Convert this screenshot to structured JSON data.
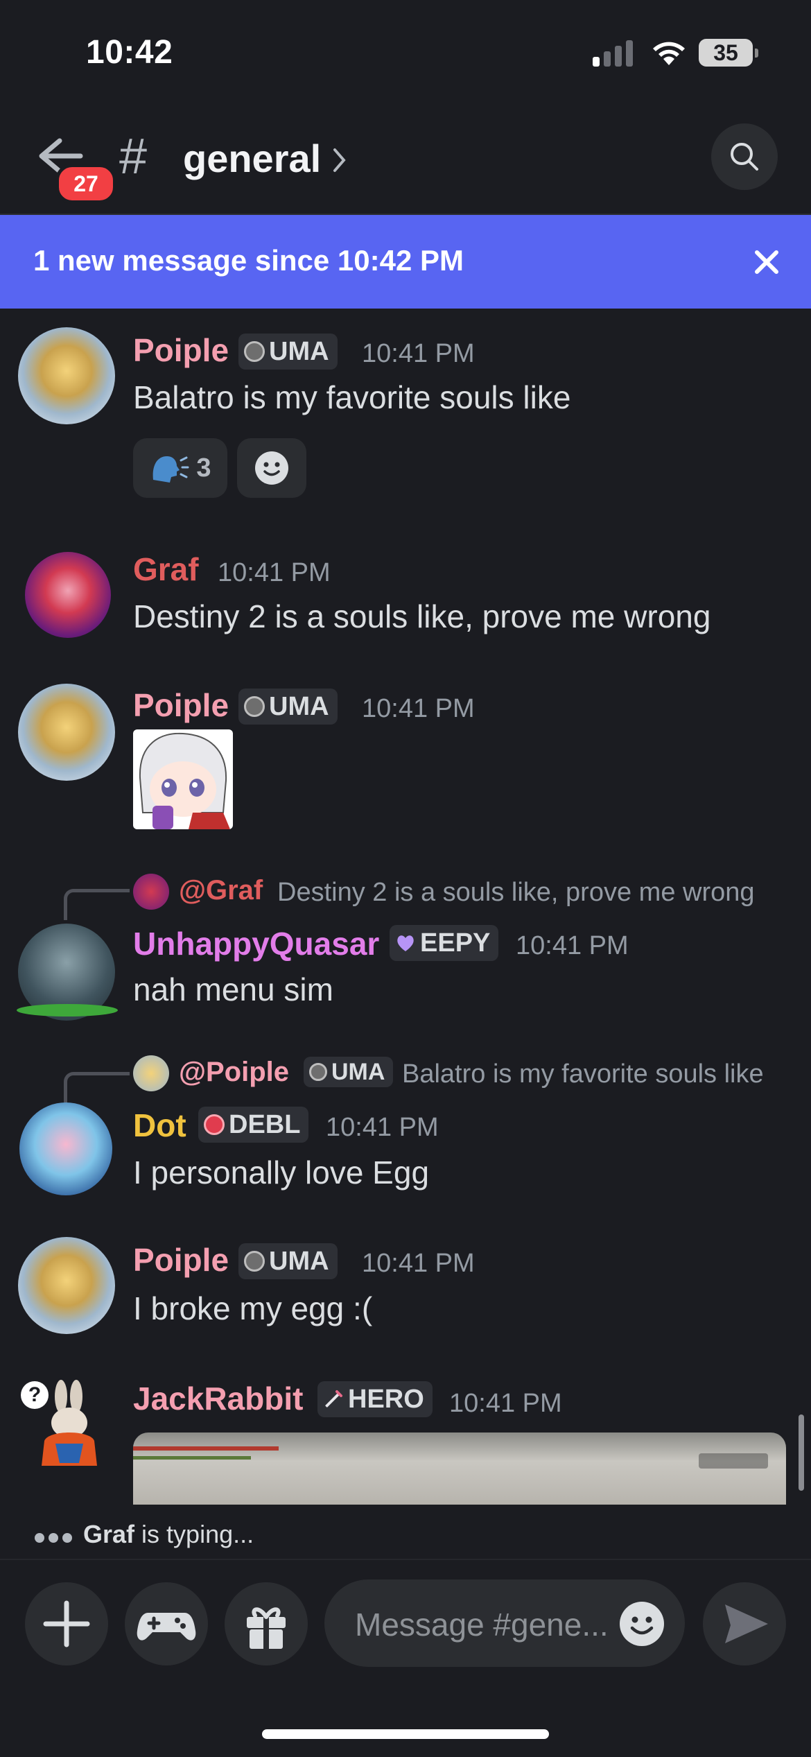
{
  "status_bar": {
    "time": "10:42",
    "battery": "35"
  },
  "header": {
    "unread_count": "27",
    "hash": "#",
    "channel_name": "general",
    "chevron": "›"
  },
  "new_messages_bar": {
    "text": "1 new message since 10:42 PM",
    "close": "✕"
  },
  "messages": [
    {
      "author": "Poiple",
      "author_color": "#f49fb0",
      "tag": "UMA",
      "time": "10:41 PM",
      "text": "Balatro is my favorite souls like",
      "reactions": [
        {
          "emoji": "speaking-head",
          "count": "3"
        },
        {
          "emoji": "add-reaction"
        }
      ]
    },
    {
      "author": "Graf",
      "author_color": "#e05d5d",
      "time": "10:41 PM",
      "text": "Destiny 2 is a souls like, prove me wrong"
    },
    {
      "author": "Poiple",
      "author_color": "#f49fb0",
      "tag": "UMA",
      "time": "10:41 PM",
      "sticker": "anime-girl-sticker"
    },
    {
      "reply": {
        "author": "@Graf",
        "author_color": "#e05d5d",
        "text": "Destiny 2 is a souls like, prove me wrong"
      },
      "author": "UnhappyQuasar",
      "author_color": "#e27de9",
      "tag": "EEPY",
      "time": "10:41 PM",
      "text": "nah menu sim"
    },
    {
      "reply": {
        "author": "@Poiple",
        "author_color": "#f49fb0",
        "tag": "UMA",
        "text": "Balatro is my favorite souls like"
      },
      "author": "Dot",
      "author_color": "#f0c23e",
      "tag": "DEBL",
      "time": "10:41 PM",
      "text": "I personally love Egg"
    },
    {
      "author": "Poiple",
      "author_color": "#f49fb0",
      "tag": "UMA",
      "time": "10:41 PM",
      "text": "I broke my egg :("
    },
    {
      "author": "JackRabbit",
      "author_color": "#f49fb0",
      "tag": "HERO",
      "time": "10:41 PM",
      "attachment": "game-screenshot"
    }
  ],
  "typing": {
    "name": "Graf",
    "suffix": " is typing..."
  },
  "composer": {
    "placeholder": "Message #gene..."
  },
  "colors": {
    "accent": "#5865f2",
    "badge_red": "#f23f43",
    "background": "#1b1c21"
  }
}
